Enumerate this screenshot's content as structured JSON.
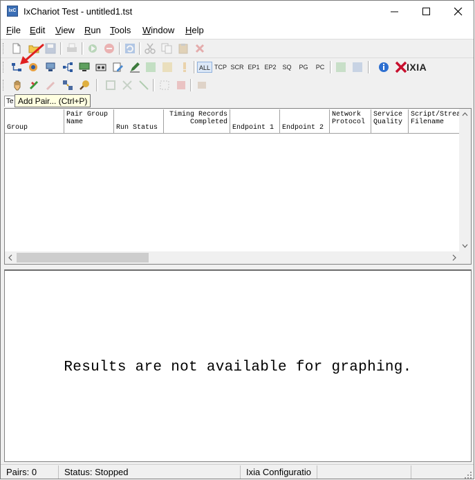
{
  "window": {
    "app_icon_text": "IxC",
    "title": "IxChariot Test - untitled1.tst"
  },
  "menu": [
    {
      "pre": "",
      "key": "F",
      "post": "ile"
    },
    {
      "pre": "",
      "key": "E",
      "post": "dit"
    },
    {
      "pre": "",
      "key": "V",
      "post": "iew"
    },
    {
      "pre": "",
      "key": "R",
      "post": "un"
    },
    {
      "pre": "",
      "key": "T",
      "post": "ools"
    },
    {
      "pre": "",
      "key": "W",
      "post": "indow"
    },
    {
      "pre": "",
      "key": "H",
      "post": "elp"
    }
  ],
  "toolbar2_filters": [
    "ALL",
    "TCP",
    "SCR",
    "EP1",
    "EP2",
    "SQ",
    "PG",
    "PC"
  ],
  "brand": "IXIA",
  "tab_label": "Te",
  "tooltip": "Add Pair... (Ctrl+P)",
  "columns": [
    "Group",
    "Pair Group\nName",
    "Run Status",
    "Timing Records\nCompleted",
    "Endpoint 1",
    "Endpoint 2",
    "Network\nProtocol",
    "Service\nQuality",
    "Script/Strea\nFilename"
  ],
  "graph_message": "Results are not available for graphing.",
  "status": {
    "pairs": "Pairs: 0",
    "status": "Status: Stopped",
    "config": "Ixia Configuratio"
  },
  "colors": {
    "accent_arrow": "#e02020",
    "brand_red": "#c8102e",
    "selected_filter": "#dce8f7"
  }
}
